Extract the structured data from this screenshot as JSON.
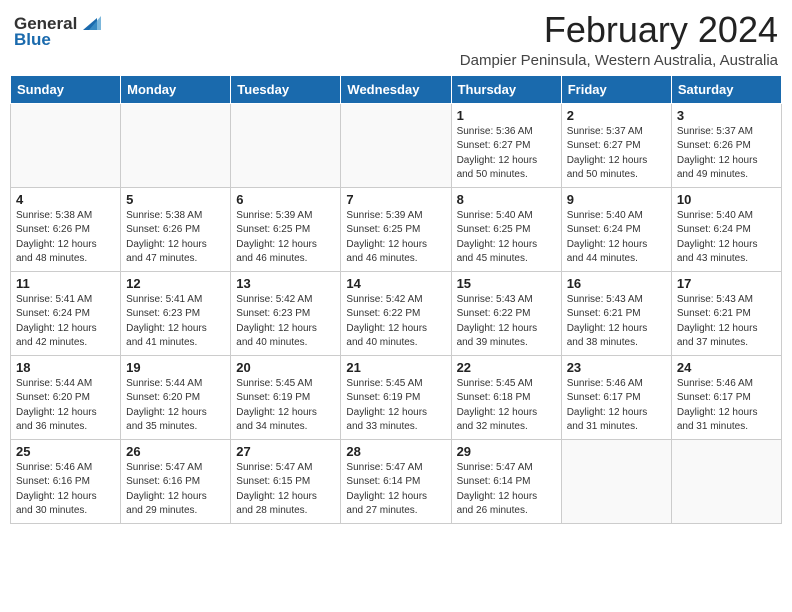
{
  "logo": {
    "general": "General",
    "blue": "Blue"
  },
  "title": "February 2024",
  "subtitle": "Dampier Peninsula, Western Australia, Australia",
  "days_of_week": [
    "Sunday",
    "Monday",
    "Tuesday",
    "Wednesday",
    "Thursday",
    "Friday",
    "Saturday"
  ],
  "weeks": [
    [
      {
        "date": "",
        "info": ""
      },
      {
        "date": "",
        "info": ""
      },
      {
        "date": "",
        "info": ""
      },
      {
        "date": "",
        "info": ""
      },
      {
        "date": "1",
        "info": "Sunrise: 5:36 AM\nSunset: 6:27 PM\nDaylight: 12 hours and 50 minutes."
      },
      {
        "date": "2",
        "info": "Sunrise: 5:37 AM\nSunset: 6:27 PM\nDaylight: 12 hours and 50 minutes."
      },
      {
        "date": "3",
        "info": "Sunrise: 5:37 AM\nSunset: 6:26 PM\nDaylight: 12 hours and 49 minutes."
      }
    ],
    [
      {
        "date": "4",
        "info": "Sunrise: 5:38 AM\nSunset: 6:26 PM\nDaylight: 12 hours and 48 minutes."
      },
      {
        "date": "5",
        "info": "Sunrise: 5:38 AM\nSunset: 6:26 PM\nDaylight: 12 hours and 47 minutes."
      },
      {
        "date": "6",
        "info": "Sunrise: 5:39 AM\nSunset: 6:25 PM\nDaylight: 12 hours and 46 minutes."
      },
      {
        "date": "7",
        "info": "Sunrise: 5:39 AM\nSunset: 6:25 PM\nDaylight: 12 hours and 46 minutes."
      },
      {
        "date": "8",
        "info": "Sunrise: 5:40 AM\nSunset: 6:25 PM\nDaylight: 12 hours and 45 minutes."
      },
      {
        "date": "9",
        "info": "Sunrise: 5:40 AM\nSunset: 6:24 PM\nDaylight: 12 hours and 44 minutes."
      },
      {
        "date": "10",
        "info": "Sunrise: 5:40 AM\nSunset: 6:24 PM\nDaylight: 12 hours and 43 minutes."
      }
    ],
    [
      {
        "date": "11",
        "info": "Sunrise: 5:41 AM\nSunset: 6:24 PM\nDaylight: 12 hours and 42 minutes."
      },
      {
        "date": "12",
        "info": "Sunrise: 5:41 AM\nSunset: 6:23 PM\nDaylight: 12 hours and 41 minutes."
      },
      {
        "date": "13",
        "info": "Sunrise: 5:42 AM\nSunset: 6:23 PM\nDaylight: 12 hours and 40 minutes."
      },
      {
        "date": "14",
        "info": "Sunrise: 5:42 AM\nSunset: 6:22 PM\nDaylight: 12 hours and 40 minutes."
      },
      {
        "date": "15",
        "info": "Sunrise: 5:43 AM\nSunset: 6:22 PM\nDaylight: 12 hours and 39 minutes."
      },
      {
        "date": "16",
        "info": "Sunrise: 5:43 AM\nSunset: 6:21 PM\nDaylight: 12 hours and 38 minutes."
      },
      {
        "date": "17",
        "info": "Sunrise: 5:43 AM\nSunset: 6:21 PM\nDaylight: 12 hours and 37 minutes."
      }
    ],
    [
      {
        "date": "18",
        "info": "Sunrise: 5:44 AM\nSunset: 6:20 PM\nDaylight: 12 hours and 36 minutes."
      },
      {
        "date": "19",
        "info": "Sunrise: 5:44 AM\nSunset: 6:20 PM\nDaylight: 12 hours and 35 minutes."
      },
      {
        "date": "20",
        "info": "Sunrise: 5:45 AM\nSunset: 6:19 PM\nDaylight: 12 hours and 34 minutes."
      },
      {
        "date": "21",
        "info": "Sunrise: 5:45 AM\nSunset: 6:19 PM\nDaylight: 12 hours and 33 minutes."
      },
      {
        "date": "22",
        "info": "Sunrise: 5:45 AM\nSunset: 6:18 PM\nDaylight: 12 hours and 32 minutes."
      },
      {
        "date": "23",
        "info": "Sunrise: 5:46 AM\nSunset: 6:17 PM\nDaylight: 12 hours and 31 minutes."
      },
      {
        "date": "24",
        "info": "Sunrise: 5:46 AM\nSunset: 6:17 PM\nDaylight: 12 hours and 31 minutes."
      }
    ],
    [
      {
        "date": "25",
        "info": "Sunrise: 5:46 AM\nSunset: 6:16 PM\nDaylight: 12 hours and 30 minutes."
      },
      {
        "date": "26",
        "info": "Sunrise: 5:47 AM\nSunset: 6:16 PM\nDaylight: 12 hours and 29 minutes."
      },
      {
        "date": "27",
        "info": "Sunrise: 5:47 AM\nSunset: 6:15 PM\nDaylight: 12 hours and 28 minutes."
      },
      {
        "date": "28",
        "info": "Sunrise: 5:47 AM\nSunset: 6:14 PM\nDaylight: 12 hours and 27 minutes."
      },
      {
        "date": "29",
        "info": "Sunrise: 5:47 AM\nSunset: 6:14 PM\nDaylight: 12 hours and 26 minutes."
      },
      {
        "date": "",
        "info": ""
      },
      {
        "date": "",
        "info": ""
      }
    ]
  ]
}
